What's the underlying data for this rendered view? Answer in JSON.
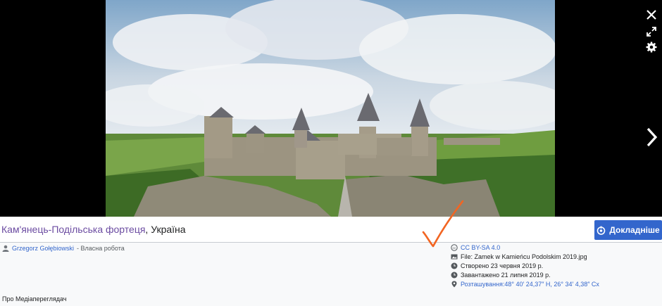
{
  "viewer": {
    "close_icon": "close-icon",
    "fullscreen_icon": "fullscreen-icon",
    "settings_icon": "gear-icon",
    "next_icon": "chevron-right-icon",
    "image_subject": "Kamianets-Podilskyi fortress photo"
  },
  "caption": {
    "title_link": "Кам'янець-Подільська фортеця",
    "title_rest": ", Україна"
  },
  "details_button": {
    "label": "Докладніше"
  },
  "author": {
    "name": "Grzegorz Gołębiowski",
    "suffix": " - Власна робота"
  },
  "meta": {
    "license": "CC BY-SA 4.0",
    "file": "File: Zamek w Kamieńcu Podolskim 2019.jpg",
    "created": "Створено 23 червня 2019 р.",
    "uploaded": "Завантажено 21 липня 2019 р.",
    "location": "Розташування:48° 40′ 24,37″ Н, 26° 34′ 4,38″ Сх"
  },
  "footer": {
    "about": "Про Медіапереглядач"
  },
  "colors": {
    "accent": "#3366cc",
    "title_link": "#6b4ba1",
    "annotation": "#f26522"
  }
}
